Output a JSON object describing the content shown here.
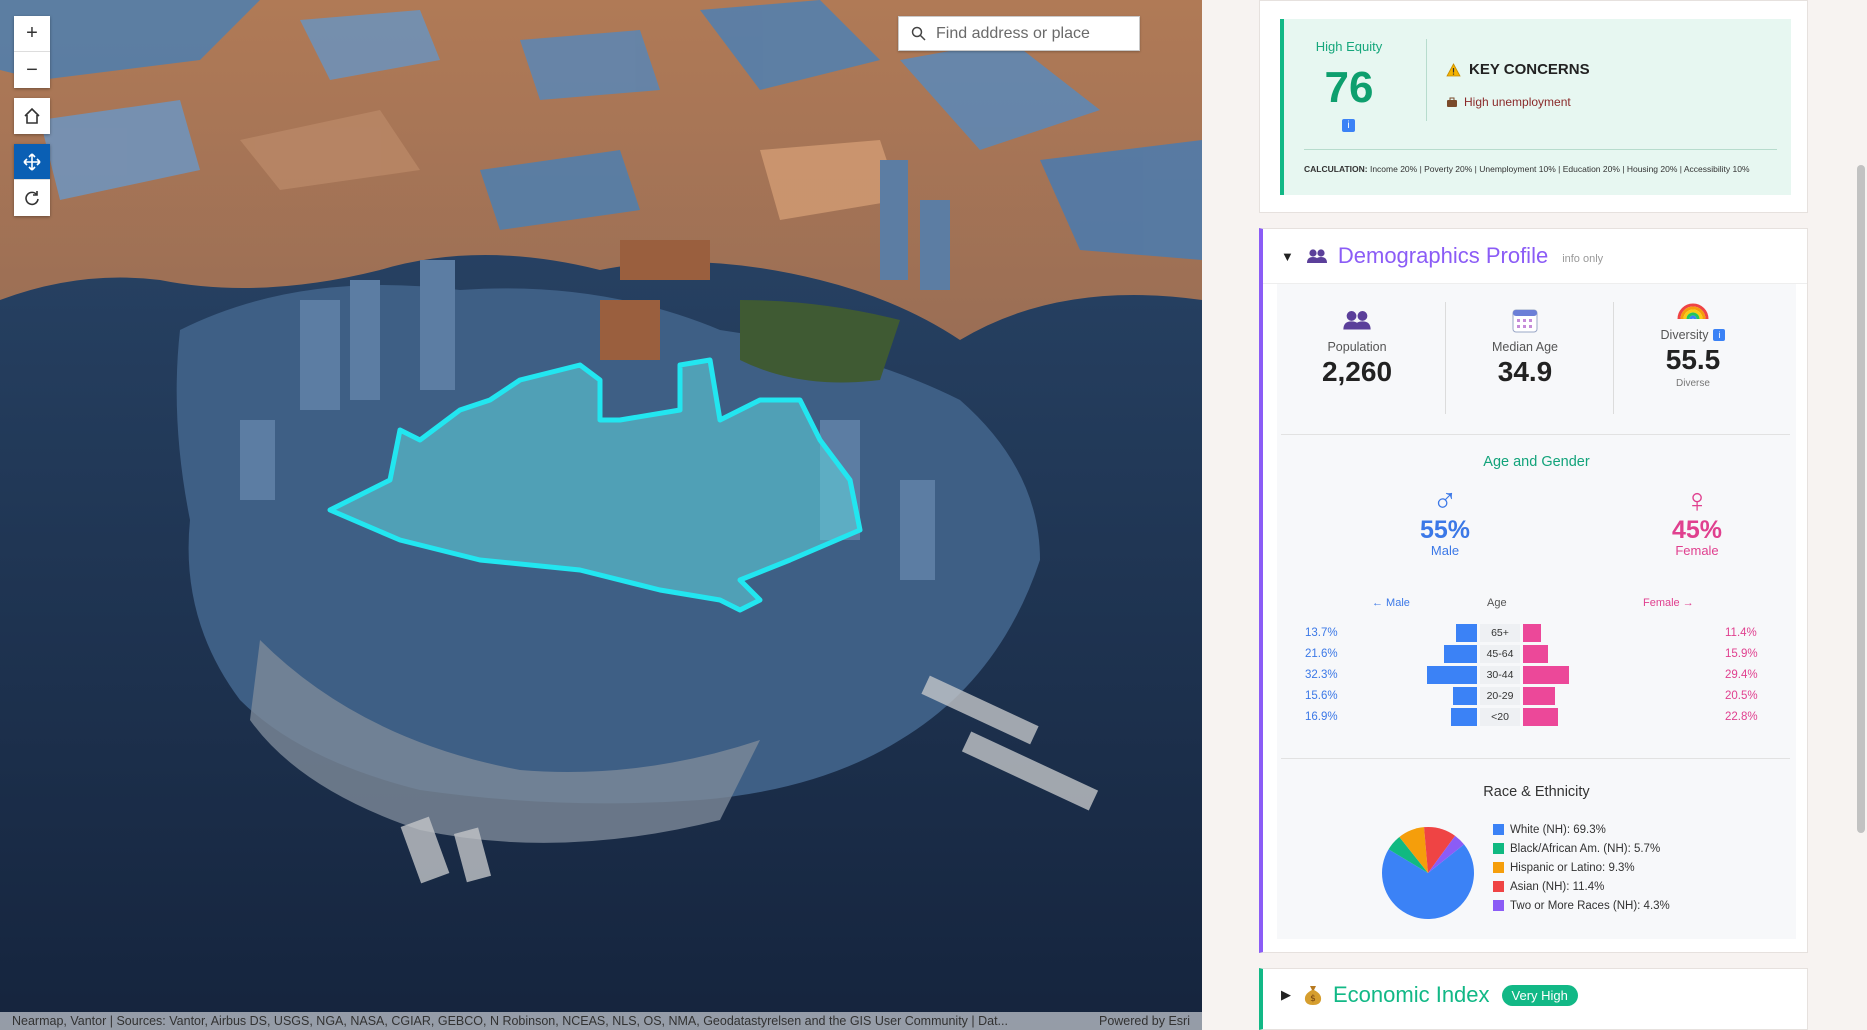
{
  "map": {
    "search_placeholder": "Find address or place",
    "controls": [
      "zoom-in",
      "zoom-out",
      "home",
      "pan",
      "rotate"
    ],
    "attribution": "Nearmap, Vantor | Sources: Vantor, Airbus DS, USGS, NGA, NASA, CGIAR, GEBCO, N Robinson, NCEAS, NLS, OS, NMA, Geodatastyrelsen and the GIS User Community | Dat...",
    "powered_by": "Powered by Esri",
    "highlight_color": "#22e6f0"
  },
  "equity": {
    "label": "High Equity",
    "score": "76",
    "info_glyph": "i",
    "key_concerns_title": "KEY CONCERNS",
    "concern_item": "High unemployment",
    "calc_label": "CALCULATION:",
    "calc_text": " Income 20% | Poverty 20% | Unemployment 10% | Education 20% | Housing 20% | Accessibility 10%"
  },
  "demographics": {
    "title": "Demographics Profile",
    "tag": "info only",
    "caret": "▼",
    "stats": {
      "population_label": "Population",
      "population_value": "2,260",
      "median_age_label": "Median Age",
      "median_age_value": "34.9",
      "diversity_label": "Diversity",
      "diversity_value": "55.5",
      "diversity_sub": "Diverse",
      "info_glyph": "i"
    },
    "age_gender_title": "Age and Gender",
    "male_symbol": "♂",
    "female_symbol": "♀",
    "male_pct": "55%",
    "male_label": "Male",
    "female_pct": "45%",
    "female_label": "Female",
    "pyramid_left_head": "← Male",
    "pyramid_mid_head": "Age",
    "pyramid_right_head": "Female →",
    "pyramid": [
      {
        "age": "65+",
        "male": "13.7%",
        "female": "11.4%",
        "male_value": 13.7,
        "female_value": 11.4
      },
      {
        "age": "45-64",
        "male": "21.6%",
        "female": "15.9%",
        "male_value": 21.6,
        "female_value": 15.9
      },
      {
        "age": "30-44",
        "male": "32.3%",
        "female": "29.4%",
        "male_value": 32.3,
        "female_value": 29.4
      },
      {
        "age": "20-29",
        "male": "15.6%",
        "female": "20.5%",
        "male_value": 15.6,
        "female_value": 20.5
      },
      {
        "age": "<20",
        "male": "16.9%",
        "female": "22.8%",
        "male_value": 16.9,
        "female_value": 22.8
      }
    ],
    "race_title": "Race & Ethnicity",
    "race": [
      {
        "label": "White (NH): 69.3%",
        "value": 69.3,
        "color": "#3b82f6"
      },
      {
        "label": "Black/African Am. (NH): 5.7%",
        "value": 5.7,
        "color": "#10b981"
      },
      {
        "label": "Hispanic or Latino: 9.3%",
        "value": 9.3,
        "color": "#f59e0b"
      },
      {
        "label": "Asian (NH): 11.4%",
        "value": 11.4,
        "color": "#ef4444"
      },
      {
        "label": "Two or More Races (NH): 4.3%",
        "value": 4.3,
        "color": "#8b5cf6"
      }
    ]
  },
  "economic": {
    "title": "Economic Index",
    "badge": "Very High",
    "caret": "▶"
  },
  "colors": {
    "equity_green": "#12b886",
    "demo_purple": "#8b5cf6",
    "male_blue": "#3b82f6",
    "female_pink": "#ec4899"
  }
}
